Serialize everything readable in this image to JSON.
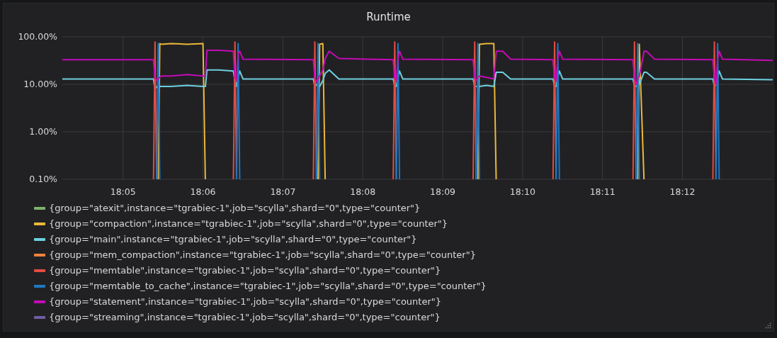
{
  "panel": {
    "title": "Runtime",
    "y_axis_labels": [
      "100.00%",
      "10.00%",
      "1.00%",
      "0.10%"
    ],
    "x_axis_labels": [
      "18:05",
      "18:06",
      "18:07",
      "18:08",
      "18:09",
      "18:10",
      "18:11",
      "18:12"
    ],
    "legend": [
      {
        "label": "{group=\"atexit\",instance=\"tgrabiec-1\",job=\"scylla\",shard=\"0\",type=\"counter\"}",
        "color": "#7eb26d"
      },
      {
        "label": "{group=\"compaction\",instance=\"tgrabiec-1\",job=\"scylla\",shard=\"0\",type=\"counter\"}",
        "color": "#eab839"
      },
      {
        "label": "{group=\"main\",instance=\"tgrabiec-1\",job=\"scylla\",shard=\"0\",type=\"counter\"}",
        "color": "#6ed0e0"
      },
      {
        "label": "{group=\"mem_compaction\",instance=\"tgrabiec-1\",job=\"scylla\",shard=\"0\",type=\"counter\"}",
        "color": "#ef843c"
      },
      {
        "label": "{group=\"memtable\",instance=\"tgrabiec-1\",job=\"scylla\",shard=\"0\",type=\"counter\"}",
        "color": "#e24d42"
      },
      {
        "label": "{group=\"memtable_to_cache\",instance=\"tgrabiec-1\",job=\"scylla\",shard=\"0\",type=\"counter\"}",
        "color": "#1f78c1"
      },
      {
        "label": "{group=\"statement\",instance=\"tgrabiec-1\",job=\"scylla\",shard=\"0\",type=\"counter\"}",
        "color": "#c40bb7"
      },
      {
        "label": "{group=\"streaming\",instance=\"tgrabiec-1\",job=\"scylla\",shard=\"0\",type=\"counter\"}",
        "color": "#705da0"
      }
    ]
  }
}
